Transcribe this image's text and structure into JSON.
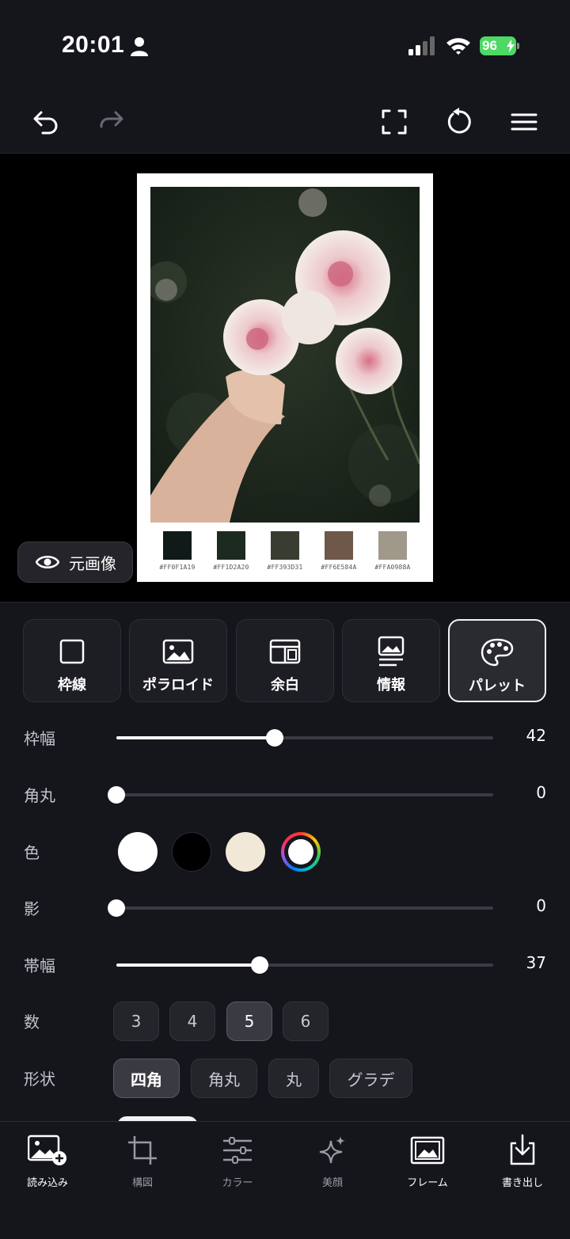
{
  "status_bar": {
    "time": "20:01",
    "battery": "96"
  },
  "toolbar": {
    "icons": [
      "undo-icon",
      "redo-icon",
      "fullscreen-icon",
      "reset-icon",
      "menu-icon"
    ]
  },
  "canvas": {
    "original_label": "元画像",
    "palette": [
      {
        "hex": "#0F1A19",
        "code": "#FF0F1A19"
      },
      {
        "hex": "#1D2A20",
        "code": "#FF1D2A20"
      },
      {
        "hex": "#393D31",
        "code": "#FF393D31"
      },
      {
        "hex": "#6E584A",
        "code": "#FF6E584A"
      },
      {
        "hex": "#A0988A",
        "code": "#FFA0988A"
      }
    ]
  },
  "tabs": [
    {
      "label": "枠線"
    },
    {
      "label": "ポラロイド"
    },
    {
      "label": "余白"
    },
    {
      "label": "情報"
    },
    {
      "label": "パレット"
    }
  ],
  "active_tab": "パレット",
  "settings": {
    "border_width": {
      "label": "枠幅",
      "value": "42",
      "fraction": 0.42
    },
    "corner_radius": {
      "label": "角丸",
      "value": "0",
      "fraction": 0.0
    },
    "color": {
      "label": "色",
      "options": [
        "#ffffff",
        "#000000",
        "#f2e8d8",
        "custom"
      ],
      "selected": "custom"
    },
    "shadow": {
      "label": "影",
      "value": "0",
      "fraction": 0.0
    },
    "band_width": {
      "label": "帯幅",
      "value": "37",
      "fraction": 0.38
    },
    "count": {
      "label": "数",
      "options": [
        "3",
        "4",
        "5",
        "6"
      ],
      "selected": "5"
    },
    "shape": {
      "label": "形状",
      "options": [
        "四角",
        "角丸",
        "丸",
        "グラデ"
      ],
      "selected": "四角"
    }
  },
  "bottom_nav": [
    {
      "label": "読み込み",
      "icon": "image-add-icon",
      "active": true
    },
    {
      "label": "構図",
      "icon": "crop-icon",
      "active": false
    },
    {
      "label": "カラー",
      "icon": "sliders-icon",
      "active": false
    },
    {
      "label": "美顔",
      "icon": "sparkle-icon",
      "active": false
    },
    {
      "label": "フレーム",
      "icon": "frame-icon",
      "active": true
    },
    {
      "label": "書き出し",
      "icon": "export-icon",
      "active": true
    }
  ],
  "colors": {
    "background": "#15151c",
    "accent": "#ffffff",
    "battery": "#4cd964"
  }
}
